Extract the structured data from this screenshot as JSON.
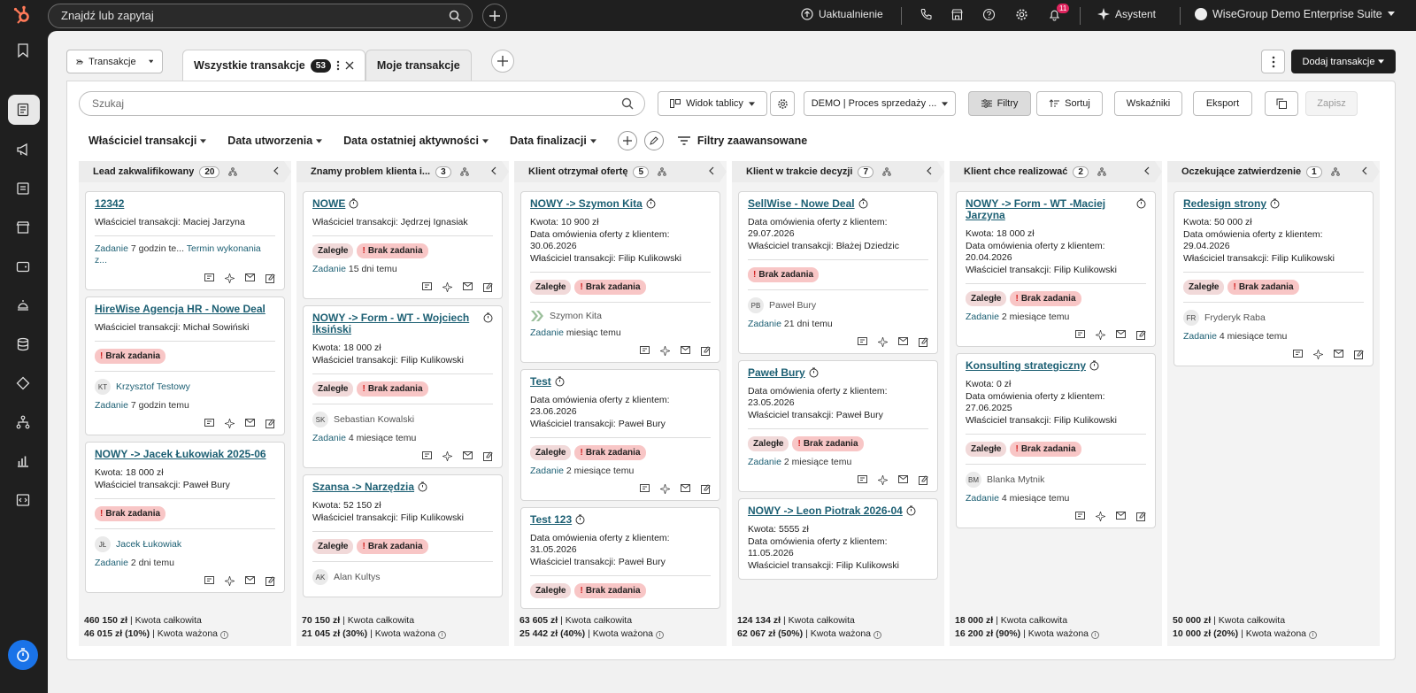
{
  "topbar": {
    "search_placeholder": "Znajdź lub zapytaj",
    "upgrade": "Uaktualnienie",
    "notif_count": "11",
    "assistant": "Asystent",
    "account": "WiseGroup Demo Enterprise Suite"
  },
  "header": {
    "object_selector": "Transakcje",
    "tab_all": "Wszystkie transakcje",
    "tab_all_count": "53",
    "tab_mine": "Moje transakcje",
    "add_deal": "Dodaj transakcje"
  },
  "toolbar": {
    "search_placeholder": "Szukaj",
    "view": "Widok tablicy",
    "pipeline": "DEMO | Proces sprzedaży ...",
    "filters": "Filtry",
    "sort": "Sortuj",
    "metrics": "Wskaźniki",
    "export": "Eksport",
    "save": "Zapisz"
  },
  "quick_filters": {
    "owner": "Właściciel transakcji",
    "created": "Data utworzenia",
    "last_activity": "Data ostatniej aktywności",
    "close_date": "Data finalizacji",
    "advanced": "Filtry zaawansowane"
  },
  "columns": [
    {
      "name": "Lead zakwalifikowany",
      "count": "20",
      "total": "460 150 zł",
      "total_label": "| Kwota całkowita",
      "weighted": "46 015 zł (10%)",
      "weighted_label": "| Kwota ważona",
      "cards": [
        {
          "title": "12342",
          "lines": [
            "Właściciel transakcji: Maciej Jarzyna"
          ],
          "task_label": "Zadanie",
          "task": "7 godzin te...",
          "task_link": "Termin wykonania z..."
        },
        {
          "title": "HireWise Agencja HR - Nowe Deal",
          "lines": [
            "Właściciel transakcji: Michał Sowiński"
          ],
          "tags": [
            "Brak zadania"
          ],
          "avatar": "KT",
          "contact": "Krzysztof Testowy",
          "task_label": "Zadanie",
          "task": "7 godzin temu"
        },
        {
          "title": "NOWY -> Jacek Łukowiak 2025-06",
          "lines": [
            "Kwota: 18 000 zł",
            "Właściciel transakcji: Paweł Bury"
          ],
          "tags": [
            "Brak zadania"
          ],
          "avatar": "JŁ",
          "contact": "Jacek Łukowiak",
          "task_label": "Zadanie",
          "task": "2 dni temu"
        }
      ]
    },
    {
      "name": "Znamy problem klienta i...",
      "count": "3",
      "total": "70 150 zł",
      "total_label": "| Kwota całkowita",
      "weighted": "21 045 zł (30%)",
      "weighted_label": "| Kwota ważona",
      "cards": [
        {
          "title": "NOWE",
          "lines": [
            "Właściciel transakcji: Jędrzej Ignasiak"
          ],
          "tags": [
            "Zaległe",
            "Brak zadania"
          ],
          "task_label": "Zadanie",
          "task": "15 dni temu"
        },
        {
          "title": "NOWY -> Form - WT - Wojciech Iksiński",
          "lines": [
            "Kwota: 18 000 zł",
            "Właściciel transakcji: Filip Kulikowski"
          ],
          "tags": [
            "Zaległe",
            "Brak zadania"
          ],
          "avatar": "SK",
          "contact": "Sebastian Kowalski",
          "task_label": "Zadanie",
          "task": "4 miesiące temu"
        },
        {
          "title": "Szansa -> Narzędzia",
          "lines": [
            "Kwota: 52 150 zł",
            "Właściciel transakcji: Filip Kulikowski"
          ],
          "tags": [
            "Zaległe",
            "Brak zadania"
          ],
          "avatar": "AK",
          "contact": "Alan Kultys"
        }
      ]
    },
    {
      "name": "Klient otrzymał ofertę",
      "count": "5",
      "total": "63 605 zł",
      "total_label": "| Kwota całkowita",
      "weighted": "25 442 zł (40%)",
      "weighted_label": "| Kwota ważona",
      "cards": [
        {
          "title": "NOWY -> Szymon Kita",
          "lines": [
            "Kwota: 10 900 zł",
            "Data omówienia oferty z klientem: 30.06.2026",
            "Właściciel transakcji: Filip Kulikowski"
          ],
          "tags": [
            "Zaległe",
            "Brak zadania"
          ],
          "avatar": "",
          "contact": "Szymon Kita",
          "task_label": "Zadanie",
          "task": "miesiąc temu"
        },
        {
          "title": "Test",
          "lines": [
            "Data omówienia oferty z klientem: 23.06.2026",
            "Właściciel transakcji: Paweł Bury"
          ],
          "tags": [
            "Zaległe",
            "Brak zadania"
          ],
          "task_label": "Zadanie",
          "task": "2 miesiące temu"
        },
        {
          "title": "Test 123",
          "lines": [
            "Data omówienia oferty z klientem: 31.05.2026",
            "Właściciel transakcji: Paweł Bury"
          ],
          "tags": [
            "Zaległe",
            "Brak zadania"
          ]
        }
      ]
    },
    {
      "name": "Klient w trakcie decyzji",
      "count": "7",
      "total": "124 134 zł",
      "total_label": "| Kwota całkowita",
      "weighted": "62 067 zł (50%)",
      "weighted_label": "| Kwota ważona",
      "cards": [
        {
          "title": "SellWise - Nowe Deal",
          "lines": [
            "Data omówienia oferty z klientem: 29.07.2026",
            "Właściciel transakcji: Błażej Dziedzic"
          ],
          "tags": [
            "Brak zadania"
          ],
          "avatar": "PB",
          "contact": "Paweł Bury",
          "task_label": "Zadanie",
          "task": "21 dni temu"
        },
        {
          "title": "Paweł Bury",
          "lines": [
            "Data omówienia oferty z klientem: 23.05.2026",
            "Właściciel transakcji: Paweł Bury"
          ],
          "tags": [
            "Zaległe",
            "Brak zadania"
          ],
          "task_label": "Zadanie",
          "task": "2 miesiące temu"
        },
        {
          "title": "NOWY -> Leon Piotrak 2026-04",
          "lines": [
            "Kwota: 5555 zł",
            "Data omówienia oferty z klientem: 11.05.2026",
            "Właściciel transakcji: Filip Kulikowski"
          ]
        }
      ]
    },
    {
      "name": "Klient chce realizować",
      "count": "2",
      "total": "18 000 zł",
      "total_label": "| Kwota całkowita",
      "weighted": "16 200 zł (90%)",
      "weighted_label": "| Kwota ważona",
      "cards": [
        {
          "title": "NOWY -> Form - WT -Maciej Jarzyna",
          "lines": [
            "Kwota: 18 000 zł",
            "Data omówienia oferty z klientem: 20.04.2026",
            "Właściciel transakcji: Filip Kulikowski"
          ],
          "tags": [
            "Zaległe",
            "Brak zadania"
          ],
          "task_label": "Zadanie",
          "task": "2 miesiące temu"
        },
        {
          "title": "Konsulting strategiczny",
          "lines": [
            "Kwota: 0 zł",
            "Data omówienia oferty z klientem: 27.06.2025",
            "Właściciel transakcji: Filip Kulikowski"
          ],
          "tags": [
            "Zaległe",
            "Brak zadania"
          ],
          "avatar": "BM",
          "contact": "Blanka Mytnik",
          "task_label": "Zadanie",
          "task": "4 miesiące temu"
        }
      ]
    },
    {
      "name": "Oczekujące zatwierdzenie",
      "count": "1",
      "total": "50 000 zł",
      "total_label": "| Kwota całkowita",
      "weighted": "10 000 zł (20%)",
      "weighted_label": "| Kwota ważona",
      "cards": [
        {
          "title": "Redesign strony",
          "lines": [
            "Kwota: 50 000 zł",
            "Data omówienia oferty z klientem: 29.04.2026",
            "Właściciel transakcji: Filip Kulikowski"
          ],
          "tags": [
            "Zaległe",
            "Brak zadania"
          ],
          "avatar": "FR",
          "contact": "Fryderyk Raba",
          "task_label": "Zadanie",
          "task": "4 miesiące temu"
        }
      ]
    }
  ]
}
